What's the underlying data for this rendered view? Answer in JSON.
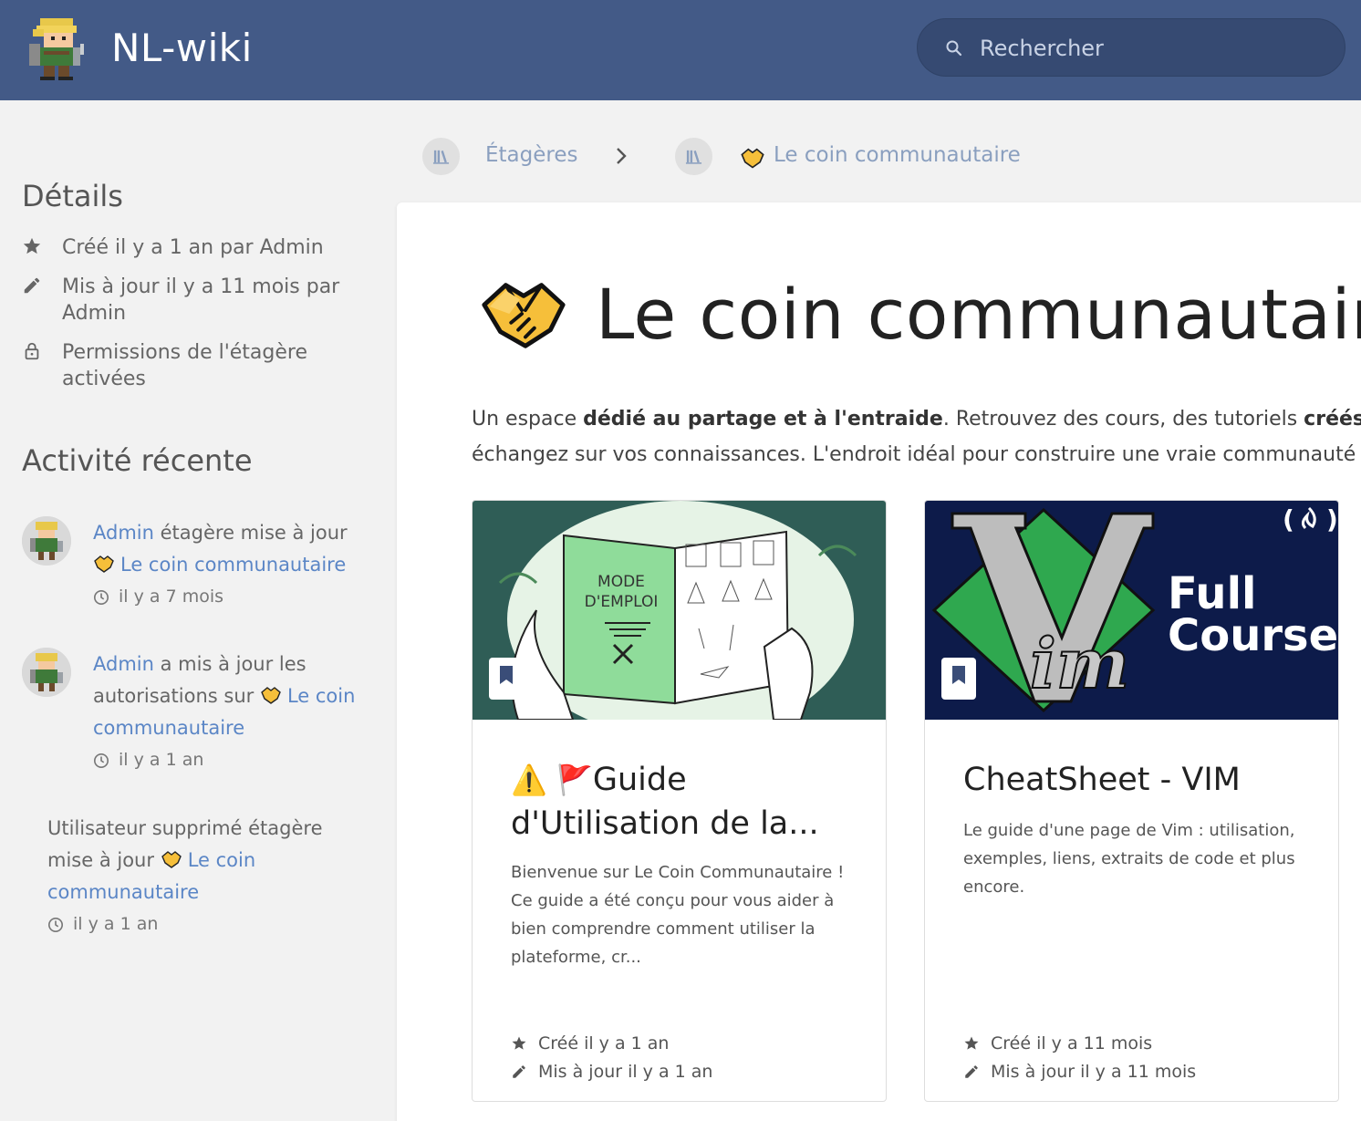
{
  "header": {
    "site_name": "NL-wiki",
    "search_placeholder": "Rechercher"
  },
  "breadcrumb": {
    "items": [
      {
        "label": "Étagères"
      },
      {
        "label": "Le coin communautaire"
      }
    ]
  },
  "sidebar": {
    "details_heading": "Détails",
    "details": [
      {
        "icon": "star-icon",
        "text": "Créé il y a 1 an par Admin"
      },
      {
        "icon": "pencil-icon",
        "text": "Mis à jour il y a 11 mois par Admin"
      },
      {
        "icon": "lock-icon",
        "text": "Permissions de l'étagère activées"
      }
    ],
    "activity_heading": "Activité récente",
    "activity": [
      {
        "user": "Admin",
        "action": "étagère mise à jour",
        "target": "Le coin communautaire",
        "time": "il y a 7 mois"
      },
      {
        "user": "Admin",
        "action": "a mis à jour les autorisations sur",
        "target": "Le coin communautaire",
        "time": "il y a 1 an"
      },
      {
        "user": "Utilisateur supprimé",
        "action": "étagère mise à jour",
        "target": "Le coin communautaire",
        "time": "il y a 1 an"
      }
    ]
  },
  "main": {
    "title": "Le coin communautaire",
    "description": {
      "p1": "Un espace ",
      "b1": "dédié au partage et à l'entraide",
      "p2": ". Retrouvez des cours, des tutoriels ",
      "b2": "créés par de",
      "line2": "échangez sur vos connaissances. L'endroit idéal pour construire une vraie communauté d'app"
    },
    "books": [
      {
        "title_prefix": "⚠️ 🚩",
        "title": "Guide d'Utilisation de la...",
        "image_text": {
          "line1": "MODE",
          "line2": "D'EMPLOI"
        },
        "description": "Bienvenue sur Le Coin Communautaire ! Ce guide a été conçu pour vous aider à bien comprendre comment utiliser la plateforme, cr...",
        "created": "Créé il y a 1 an",
        "updated": "Mis à jour il y a 1 an"
      },
      {
        "title": "CheatSheet - VIM",
        "image_text": {
          "line1": "Full",
          "line2": "Course"
        },
        "description": "Le guide d'une page de Vim : utilisation, exemples, liens, extraits de code et plus encore.",
        "created": "Créé il y a 11 mois",
        "updated": "Mis à jour il y a 11 mois"
      }
    ]
  },
  "colors": {
    "header_bg": "#435a87",
    "link": "#5b86c6",
    "page_bg": "#f2f2f2"
  }
}
